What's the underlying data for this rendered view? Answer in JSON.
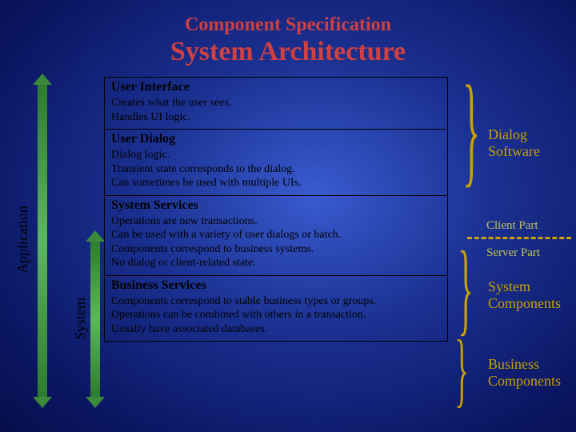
{
  "title1": "Component Specification",
  "title2": "System Architecture",
  "rows": [
    {
      "head": "User Interface",
      "body": "Creates what the user sees.\nHandles UI logic."
    },
    {
      "head": "User Dialog",
      "body": "Dialog logic.\nTransient state corresponds to the dialog.\nCan sometimes be used with multiple UIs."
    },
    {
      "head": "System Services",
      "body": "Operations are new transactions.\nCan be used with a variety of user dialogs or batch.\nComponents correspond to business systems.\nNo dialog or client-related state."
    },
    {
      "head": "Business Services",
      "body": "Components correspond to stable business types or groups.\nOperations can be combined with others in a transaction.\nUsually have associated databases."
    }
  ],
  "vlabels": {
    "application": "Application",
    "system": "System"
  },
  "rlabels": {
    "dialog_software": "Dialog\nSoftware",
    "client_part": "Client Part",
    "server_part": "Server Part",
    "system_components": "System\nComponents",
    "business_components": "Business\nComponents"
  }
}
